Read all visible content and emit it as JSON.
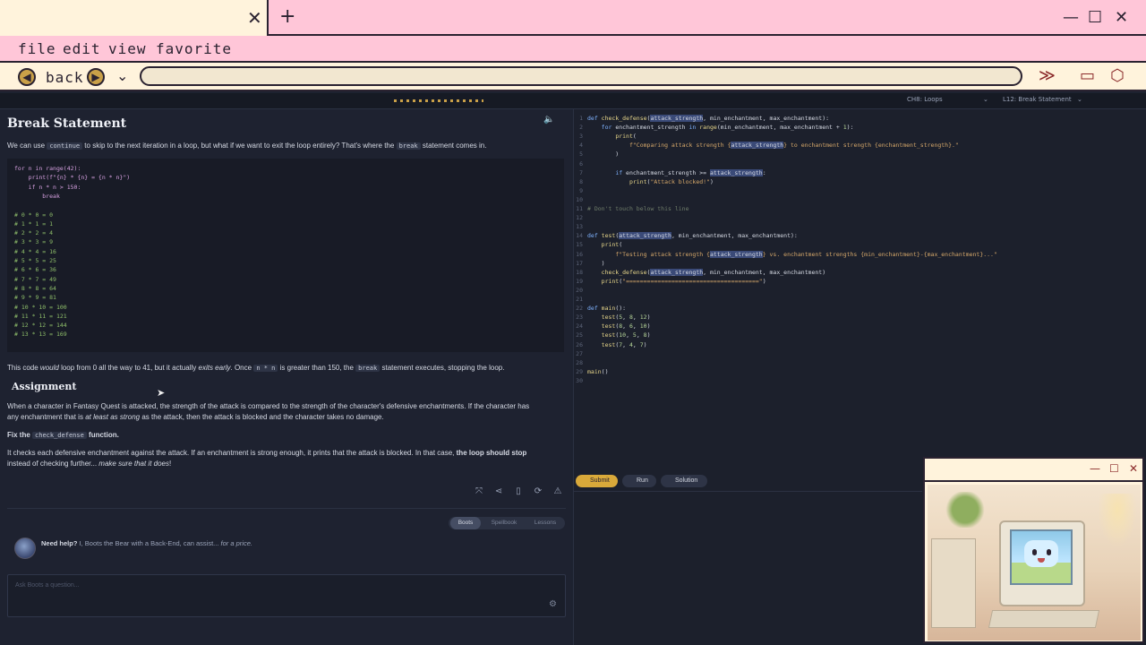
{
  "browser": {
    "tab_close": "✕",
    "new_tab": "+",
    "window_controls": [
      "—",
      "☐",
      "✕"
    ],
    "menu": [
      "file",
      "edit",
      "view",
      "favorite"
    ],
    "back_label": "back",
    "icons": [
      "back-arrow-icon",
      "forward-arrow-icon",
      "chevron-down-icon",
      "fast-forward-icon",
      "folder-icon",
      "puzzle-icon"
    ],
    "accent_color": "#ffc6d8"
  },
  "app_header": {
    "chapter_select": "CH8: Loops",
    "lesson_select": "L12: Break Statement"
  },
  "lesson": {
    "title": "Break Statement",
    "intro_a": "We can use",
    "intro_code1": "continue",
    "intro_b": "to skip to the next iteration in a loop, but what if we want to exit the loop entirely? That's where the",
    "intro_code2": "break",
    "intro_c": "statement comes in.",
    "code_lines": [
      "for n in range(42):",
      "    print(f\"{n} * {n} = {n * n}\")",
      "    if n * n > 150:",
      "        break",
      "",
      "# 0 * 0 = 0",
      "# 1 * 1 = 1",
      "# 2 * 2 = 4",
      "# 3 * 3 = 9",
      "# 4 * 4 = 16",
      "# 5 * 5 = 25",
      "# 6 * 6 = 36",
      "# 7 * 7 = 49",
      "# 8 * 8 = 64",
      "# 9 * 9 = 81",
      "# 10 * 10 = 100",
      "# 11 * 11 = 121",
      "# 12 * 12 = 144",
      "# 13 * 13 = 169"
    ],
    "explain_a": "This code",
    "explain_would": "would",
    "explain_b": "loop from 0 all the way to 41, but it actually",
    "explain_exits": "exits early",
    "explain_c": ". Once",
    "explain_code1": "n * n",
    "explain_d": "is greater than 150, the",
    "explain_code2": "break",
    "explain_e": "statement executes, stopping the loop.",
    "assignment_title": "Assignment",
    "assign_p1_a": "When a character in Fantasy Quest is attacked, the strength of the attack is compared to the strength of the character's defensive enchantments. If the character has",
    "assign_p1_b": "any enchantment that is",
    "assign_p1_em": "at least as strong",
    "assign_p1_c": "as the attack, then the attack is blocked and the character takes no damage.",
    "fix_a": "Fix the",
    "fix_code": "check_defense",
    "fix_b": "function.",
    "assign_p3_a": "It checks each defensive enchantment against the attack. If an enchantment is strong enough, it prints that the attack is blocked. In that case,",
    "assign_p3_bold": "the loop should stop",
    "assign_p3_b": "instead of checking further...",
    "assign_p3_em": "make sure that it does",
    "assign_p3_c": "!",
    "tabs": [
      "Boots",
      "Spellbook",
      "Lessons"
    ],
    "help_bold": "Need help?",
    "help_text": "I, Boots the Bear with a Back-End, can assist...",
    "help_em": "for a price.",
    "ask_placeholder": "Ask Boots a question..."
  },
  "editor": {
    "line_numbers": [
      "1",
      "2",
      "3",
      "4",
      "5",
      "6",
      "7",
      "8",
      "9",
      "10",
      "11",
      "12",
      "13",
      "14",
      "15",
      "16",
      "17",
      "18",
      "19",
      "20",
      "21",
      "22",
      "23",
      "24",
      "25",
      "26",
      "27",
      "28",
      "29",
      "30"
    ],
    "buttons": [
      "Submit",
      "Run",
      "Solution"
    ]
  },
  "popup": {
    "controls": [
      "—",
      "☐",
      "✕"
    ]
  }
}
